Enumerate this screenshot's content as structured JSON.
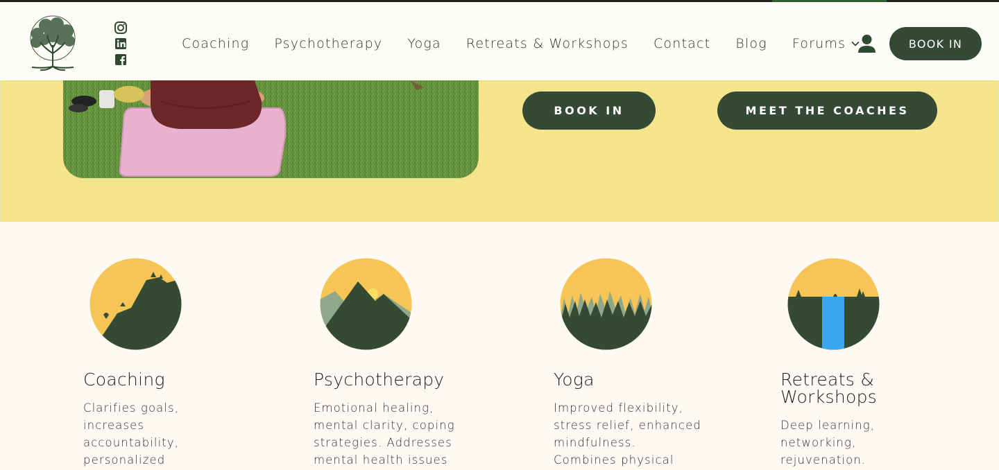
{
  "header": {
    "socials": [
      {
        "name": "instagram-icon"
      },
      {
        "name": "linkedin-icon"
      },
      {
        "name": "facebook-icon"
      }
    ],
    "nav": [
      {
        "label": "Coaching"
      },
      {
        "label": "Psychotherapy"
      },
      {
        "label": "Yoga"
      },
      {
        "label": "Retreats & Workshops"
      },
      {
        "label": "Contact"
      },
      {
        "label": "Blog"
      },
      {
        "label": "Forums",
        "has_dropdown": true
      }
    ],
    "book_label": "BOOK IN"
  },
  "hero": {
    "book_label": "BOOK IN",
    "meet_label": "MEET THE COACHES"
  },
  "colors": {
    "brand_dark_green": "#354a35",
    "hero_yellow": "#f4e48c",
    "page_bg": "#fdfaf4",
    "icon_sun": "#f7c556",
    "icon_water": "#3aa6f0"
  },
  "services": [
    {
      "title": "Coaching",
      "description": "Clarifies goals, increases accountability, personalized guidance.",
      "icon": "mountain-climb-icon"
    },
    {
      "title": "Psychotherapy",
      "description": "Emotional healing, mental clarity, coping strategies. Addresses mental health issues",
      "icon": "mountain-sunrise-icon"
    },
    {
      "title": "Yoga",
      "description": "Improved flexibility, stress relief, enhanced mindfulness. Combines physical postures,",
      "icon": "grass-field-icon"
    },
    {
      "title": "Retreats & Workshops",
      "description": "Deep learning, networking, rejuvenation.",
      "icon": "waterfall-icon"
    }
  ]
}
